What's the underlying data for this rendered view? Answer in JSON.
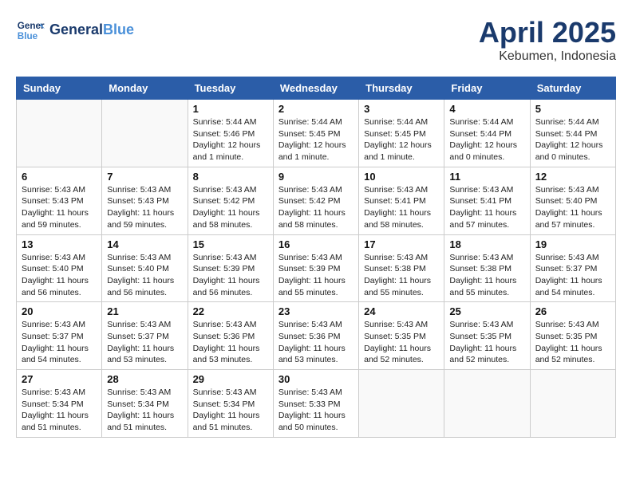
{
  "header": {
    "logo_line1": "General",
    "logo_line2": "Blue",
    "month_title": "April 2025",
    "subtitle": "Kebumen, Indonesia"
  },
  "weekdays": [
    "Sunday",
    "Monday",
    "Tuesday",
    "Wednesday",
    "Thursday",
    "Friday",
    "Saturday"
  ],
  "weeks": [
    [
      {
        "day": "",
        "info": ""
      },
      {
        "day": "",
        "info": ""
      },
      {
        "day": "1",
        "info": "Sunrise: 5:44 AM\nSunset: 5:46 PM\nDaylight: 12 hours and 1 minute."
      },
      {
        "day": "2",
        "info": "Sunrise: 5:44 AM\nSunset: 5:45 PM\nDaylight: 12 hours and 1 minute."
      },
      {
        "day": "3",
        "info": "Sunrise: 5:44 AM\nSunset: 5:45 PM\nDaylight: 12 hours and 1 minute."
      },
      {
        "day": "4",
        "info": "Sunrise: 5:44 AM\nSunset: 5:44 PM\nDaylight: 12 hours and 0 minutes."
      },
      {
        "day": "5",
        "info": "Sunrise: 5:44 AM\nSunset: 5:44 PM\nDaylight: 12 hours and 0 minutes."
      }
    ],
    [
      {
        "day": "6",
        "info": "Sunrise: 5:43 AM\nSunset: 5:43 PM\nDaylight: 11 hours and 59 minutes."
      },
      {
        "day": "7",
        "info": "Sunrise: 5:43 AM\nSunset: 5:43 PM\nDaylight: 11 hours and 59 minutes."
      },
      {
        "day": "8",
        "info": "Sunrise: 5:43 AM\nSunset: 5:42 PM\nDaylight: 11 hours and 58 minutes."
      },
      {
        "day": "9",
        "info": "Sunrise: 5:43 AM\nSunset: 5:42 PM\nDaylight: 11 hours and 58 minutes."
      },
      {
        "day": "10",
        "info": "Sunrise: 5:43 AM\nSunset: 5:41 PM\nDaylight: 11 hours and 58 minutes."
      },
      {
        "day": "11",
        "info": "Sunrise: 5:43 AM\nSunset: 5:41 PM\nDaylight: 11 hours and 57 minutes."
      },
      {
        "day": "12",
        "info": "Sunrise: 5:43 AM\nSunset: 5:40 PM\nDaylight: 11 hours and 57 minutes."
      }
    ],
    [
      {
        "day": "13",
        "info": "Sunrise: 5:43 AM\nSunset: 5:40 PM\nDaylight: 11 hours and 56 minutes."
      },
      {
        "day": "14",
        "info": "Sunrise: 5:43 AM\nSunset: 5:40 PM\nDaylight: 11 hours and 56 minutes."
      },
      {
        "day": "15",
        "info": "Sunrise: 5:43 AM\nSunset: 5:39 PM\nDaylight: 11 hours and 56 minutes."
      },
      {
        "day": "16",
        "info": "Sunrise: 5:43 AM\nSunset: 5:39 PM\nDaylight: 11 hours and 55 minutes."
      },
      {
        "day": "17",
        "info": "Sunrise: 5:43 AM\nSunset: 5:38 PM\nDaylight: 11 hours and 55 minutes."
      },
      {
        "day": "18",
        "info": "Sunrise: 5:43 AM\nSunset: 5:38 PM\nDaylight: 11 hours and 55 minutes."
      },
      {
        "day": "19",
        "info": "Sunrise: 5:43 AM\nSunset: 5:37 PM\nDaylight: 11 hours and 54 minutes."
      }
    ],
    [
      {
        "day": "20",
        "info": "Sunrise: 5:43 AM\nSunset: 5:37 PM\nDaylight: 11 hours and 54 minutes."
      },
      {
        "day": "21",
        "info": "Sunrise: 5:43 AM\nSunset: 5:37 PM\nDaylight: 11 hours and 53 minutes."
      },
      {
        "day": "22",
        "info": "Sunrise: 5:43 AM\nSunset: 5:36 PM\nDaylight: 11 hours and 53 minutes."
      },
      {
        "day": "23",
        "info": "Sunrise: 5:43 AM\nSunset: 5:36 PM\nDaylight: 11 hours and 53 minutes."
      },
      {
        "day": "24",
        "info": "Sunrise: 5:43 AM\nSunset: 5:35 PM\nDaylight: 11 hours and 52 minutes."
      },
      {
        "day": "25",
        "info": "Sunrise: 5:43 AM\nSunset: 5:35 PM\nDaylight: 11 hours and 52 minutes."
      },
      {
        "day": "26",
        "info": "Sunrise: 5:43 AM\nSunset: 5:35 PM\nDaylight: 11 hours and 52 minutes."
      }
    ],
    [
      {
        "day": "27",
        "info": "Sunrise: 5:43 AM\nSunset: 5:34 PM\nDaylight: 11 hours and 51 minutes."
      },
      {
        "day": "28",
        "info": "Sunrise: 5:43 AM\nSunset: 5:34 PM\nDaylight: 11 hours and 51 minutes."
      },
      {
        "day": "29",
        "info": "Sunrise: 5:43 AM\nSunset: 5:34 PM\nDaylight: 11 hours and 51 minutes."
      },
      {
        "day": "30",
        "info": "Sunrise: 5:43 AM\nSunset: 5:33 PM\nDaylight: 11 hours and 50 minutes."
      },
      {
        "day": "",
        "info": ""
      },
      {
        "day": "",
        "info": ""
      },
      {
        "day": "",
        "info": ""
      }
    ]
  ]
}
